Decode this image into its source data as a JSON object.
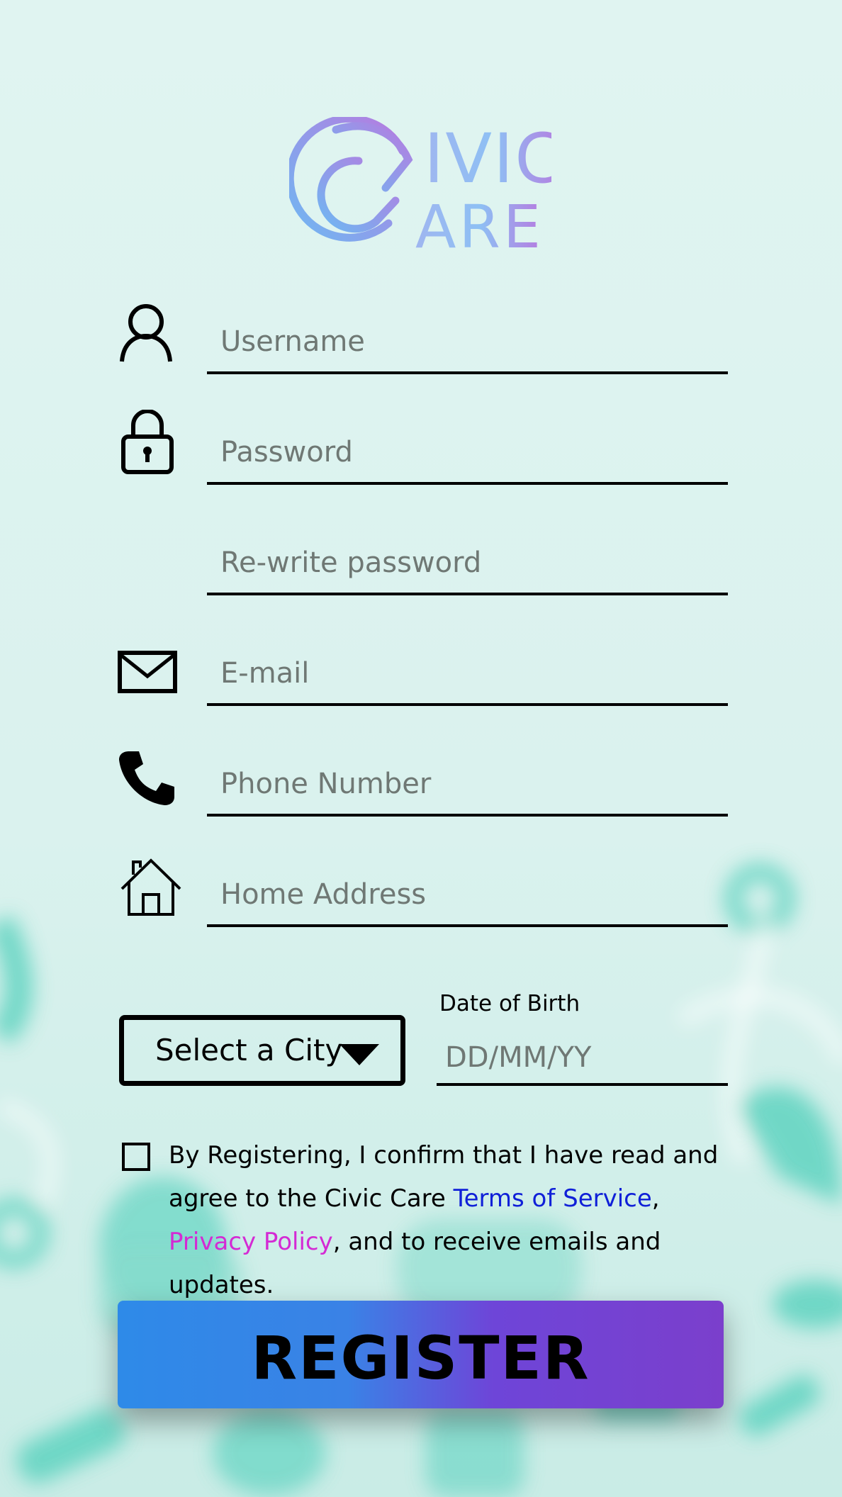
{
  "brand": {
    "logo_line1": "IVIC",
    "logo_line2": "ARE",
    "logo_gradient_start": "#6fb8f2",
    "logo_gradient_end": "#b67be0"
  },
  "form": {
    "username": {
      "value": "",
      "placeholder": "Username",
      "icon": "user-icon"
    },
    "password": {
      "value": "",
      "placeholder": "Password",
      "icon": "lock-icon"
    },
    "rewrite_password": {
      "value": "",
      "placeholder": "Re-write password"
    },
    "email": {
      "value": "",
      "placeholder": "E-mail",
      "icon": "envelope-icon"
    },
    "phone": {
      "value": "",
      "placeholder": "Phone Number",
      "icon": "phone-icon"
    },
    "address": {
      "value": "",
      "placeholder": "Home Address",
      "icon": "home-icon"
    },
    "city": {
      "selected": "Select a City"
    },
    "dob": {
      "label": "Date of Birth",
      "value": "",
      "placeholder": "DD/MM/YY"
    }
  },
  "terms": {
    "checked": false,
    "text_before": "By Registering, I confirm that I have read and agree to the Civic Care ",
    "tos_link": "Terms of Service",
    "separator": ", ",
    "privacy_link": "Privacy Policy",
    "text_after": ", and to receive emails and updates.",
    "tos_color": "#1020d8",
    "privacy_color": "#d42ad4"
  },
  "register_button": {
    "label": "REGISTER"
  },
  "colors": {
    "background": "#ddf3ef",
    "accent_teal": "#5fd3c0",
    "button_blue": "#2e8ae8",
    "button_purple": "#7b3fcc"
  }
}
